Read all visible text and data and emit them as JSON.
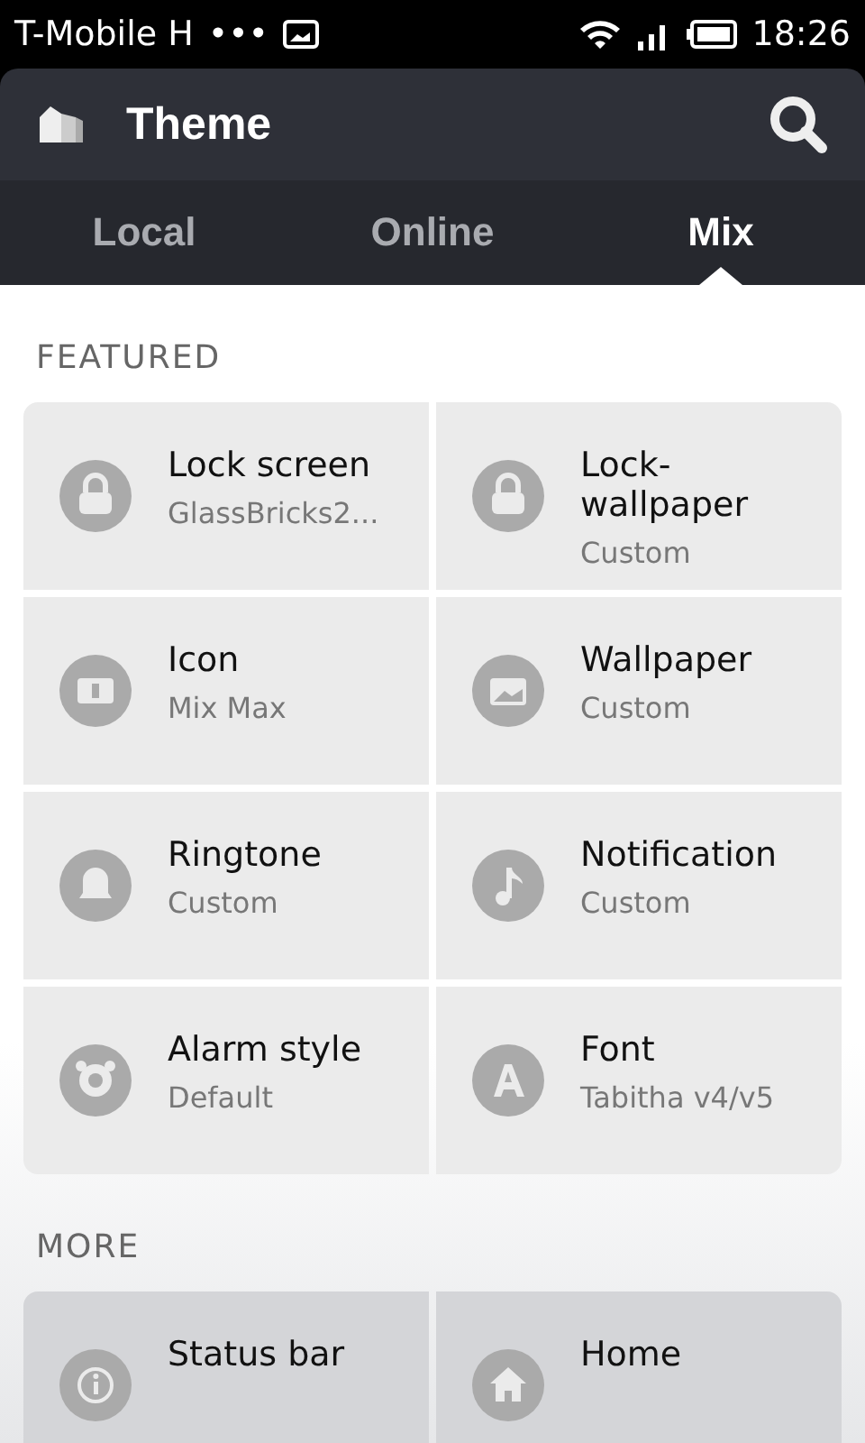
{
  "status_bar": {
    "carrier": "T-Mobile H",
    "dots": "•••",
    "time": "18:26"
  },
  "header": {
    "title": "Theme"
  },
  "tabs": [
    {
      "label": "Local",
      "selected": false
    },
    {
      "label": "Online",
      "selected": false
    },
    {
      "label": "Mix",
      "selected": true
    }
  ],
  "sections": [
    {
      "heading": "FEATURED",
      "items": [
        {
          "kind": "lock",
          "title": "Lock screen",
          "subtitle": "GlassBricks2..."
        },
        {
          "kind": "lockwallpaper",
          "title": "Lock-wallpaper",
          "subtitle": "Custom"
        },
        {
          "kind": "icon",
          "title": "Icon",
          "subtitle": "Mix Max"
        },
        {
          "kind": "wallpaper",
          "title": "Wallpaper",
          "subtitle": "Custom"
        },
        {
          "kind": "ringtone",
          "title": "Ringtone",
          "subtitle": "Custom"
        },
        {
          "kind": "notification",
          "title": "Notification",
          "subtitle": "Custom"
        },
        {
          "kind": "alarm",
          "title": "Alarm style",
          "subtitle": "Default"
        },
        {
          "kind": "font",
          "title": "Font",
          "subtitle": "Tabitha v4/v5"
        }
      ]
    },
    {
      "heading": "MORE",
      "items": [
        {
          "kind": "info",
          "title": "Status bar"
        },
        {
          "kind": "home",
          "title": "Home"
        }
      ]
    }
  ]
}
